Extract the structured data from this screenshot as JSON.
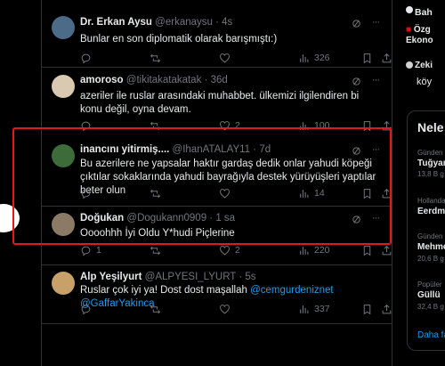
{
  "tweets": [
    {
      "name": "Dr. Erkan Aysu",
      "handle": "@erkanaysu",
      "dot": "·",
      "time": "4s",
      "text": "Bunlar en son diplomatik olarak barışmıştı:)",
      "views": "326",
      "avatar_color": "#4b6b88"
    },
    {
      "name": "amoroso",
      "handle": "@tikitakatakatak",
      "dot": "·",
      "time": "36d",
      "text": "azeriler ile ruslar arasındaki muhabbet. ülkemizi ilgilendiren bi konu değil, oyna devam.",
      "likes": "2",
      "views": "100",
      "avatar_color": "#d9c9b0"
    },
    {
      "name": "inancını yitirmiş....",
      "handle": "@IhanATALAY11",
      "dot": "·",
      "time": "7d",
      "text": "Bu azerilere ne yapsalar haktır gardaş dedik onlar yahudi köpeği çıktılar sokaklarında yahudi bayrağıyla destek yürüyüşleri yaptılar beter olun",
      "views": "14",
      "avatar_color": "#3d6b3a"
    },
    {
      "name": "Doğukan",
      "handle": "@Dogukann0909",
      "dot": "·",
      "time": "1 sa",
      "text": "Oooohhh İyi Oldu Y*hudi Piçlerine",
      "replies": "1",
      "likes": "2",
      "views": "220",
      "avatar_color": "#8a7a66"
    },
    {
      "name": "Alp Yeşilyurt",
      "handle": "@ALPYESI_LYURT",
      "dot": "·",
      "time": "5s",
      "text_plain": "Ruslar çok iyi ya! Dost dost maşallah ",
      "mention1": "@cemgurdeniznet",
      "mention2": "@GaffarYakinca",
      "views": "337",
      "avatar_color": "#c8a06a"
    }
  ],
  "sidebar": {
    "top_name": "Bah",
    "flag_text": "Özg",
    "sub_text": "Ekono",
    "user2": "Zeki",
    "user2_text": "köy",
    "trends_title": "Nele",
    "trends": [
      {
        "context": "Günden",
        "title": "Tuğyan",
        "count": "13,8 B g"
      },
      {
        "context": "Hollanda",
        "title": "Eerdm",
        "count": ""
      },
      {
        "context": "Günden",
        "title": "Mehme",
        "count": "20,6 B g"
      },
      {
        "context": "Popüler",
        "title": "Güllü",
        "count": "32,4 B g"
      }
    ],
    "show_more": "Daha fa"
  },
  "colors": {
    "accent": "#1d9bf0",
    "highlight": "#e0191c"
  }
}
